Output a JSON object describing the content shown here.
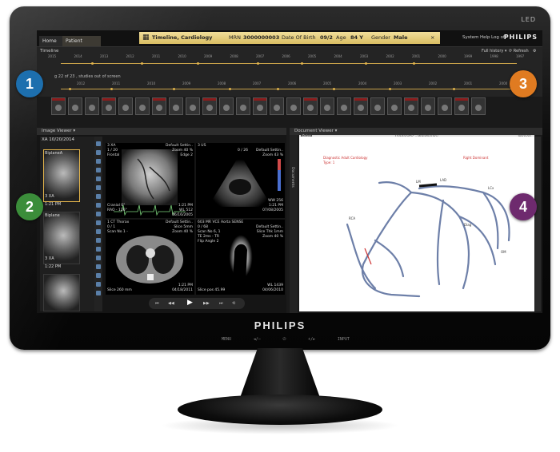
{
  "bezel": {
    "led_label": "LED",
    "brand": "PHILIPS",
    "controls": [
      "MENU",
      "◄/–",
      "⏻",
      "+/►",
      "INPUT"
    ]
  },
  "app": {
    "tabs": [
      "Home",
      "Patient"
    ],
    "banner": {
      "title": "Timeline, Cardiology",
      "mrn_label": "MRN",
      "mrn": "3000000003",
      "dob_label": "Date Of Birth",
      "dob": "09/2",
      "age_label": "Age",
      "age": "84 Y",
      "gender_label": "Gender",
      "gender": "Male",
      "close": "×"
    },
    "menu": [
      "System",
      "Help",
      "Log off"
    ],
    "brand": "PHILIPS",
    "timeline": {
      "label": "Timeline",
      "full_history": "Full history ▾",
      "refresh": "⟳ Refresh",
      "note": "g 22 of 23 , studies out of screen",
      "years_top": [
        "2015",
        "2014",
        "2013",
        "2012",
        "2011",
        "2010",
        "2009",
        "2008",
        "2007",
        "2006",
        "2005",
        "2004",
        "2003",
        "2002",
        "2001",
        "2000",
        "1999",
        "1998",
        "1997"
      ],
      "years_mid": [
        "2012",
        "2011",
        "2010",
        "2009",
        "2008",
        "2007",
        "2006",
        "2005",
        "2004",
        "2003",
        "2002",
        "2001",
        "2000"
      ]
    },
    "image_viewer": {
      "label": "Image Viewer ▾",
      "series_title": "XA 10/20/2014",
      "series": [
        {
          "name": "BiplaneA",
          "label": "3 XA",
          "time": "1:21 PM"
        },
        {
          "name": "Biplane",
          "label": "3 XA",
          "time": "1:22 PM"
        }
      ],
      "cells": [
        {
          "tl": [
            "3 XA",
            "1 / 20",
            "Frontal"
          ],
          "tr": [
            "Default Settin..",
            "Zoom 40 %",
            "Edge 2"
          ],
          "bl": [
            "Cranial 0°",
            "RAO - 126°"
          ],
          "br": [
            "1:21 PM",
            "WL 512",
            "06/16/2005"
          ]
        },
        {
          "tl": [
            "3 US",
            "0 / 26"
          ],
          "tr": [
            "Default Settin..",
            "Zoom 43 %"
          ],
          "bl": [],
          "br": [
            "WW 256",
            "1:21 PM",
            "07/08/2005"
          ]
        },
        {
          "tl": [
            "1 CT Thorax",
            "0 / 1",
            "Scan No 1 -",
            ""
          ],
          "tr": [
            "Default Settin..",
            "Slice 5mm",
            "Zoom 40 %"
          ],
          "bl": [
            "Slice 260 mm"
          ],
          "br": [
            "1:21 PM",
            "04/18/2011"
          ]
        },
        {
          "tl": [
            "603 MR VCE Aorta SENSE",
            "0 / 68",
            "Scan No 6, 1",
            "TE 2ms - TR",
            "Flip Angle 2"
          ],
          "tr": [
            "Default Settin..",
            "Slice Thk 1mm",
            "Zoom 40 %"
          ],
          "bl": [
            "Slice pos 45.99"
          ],
          "br": [
            "WL 1439",
            "04/06/2010"
          ]
        }
      ]
    },
    "document_viewer": {
      "label": "Document Viewer ▾",
      "print": "Print",
      "title": "Diagnostic - Preliminary",
      "version": "Version",
      "side_label": "Documents",
      "diagram_labels": [
        "Diagnostic Adult Cardiology",
        "Type: 1",
        "Right Dominant",
        "LAD",
        "LCx",
        "RCA",
        "OM",
        "Diag",
        "LM"
      ]
    }
  },
  "callouts": [
    {
      "num": "1",
      "color": "#1d6fae"
    },
    {
      "num": "2",
      "color": "#3b8d3a"
    },
    {
      "num": "3",
      "color": "#e07b21"
    },
    {
      "num": "4",
      "color": "#6e2a6e"
    }
  ]
}
